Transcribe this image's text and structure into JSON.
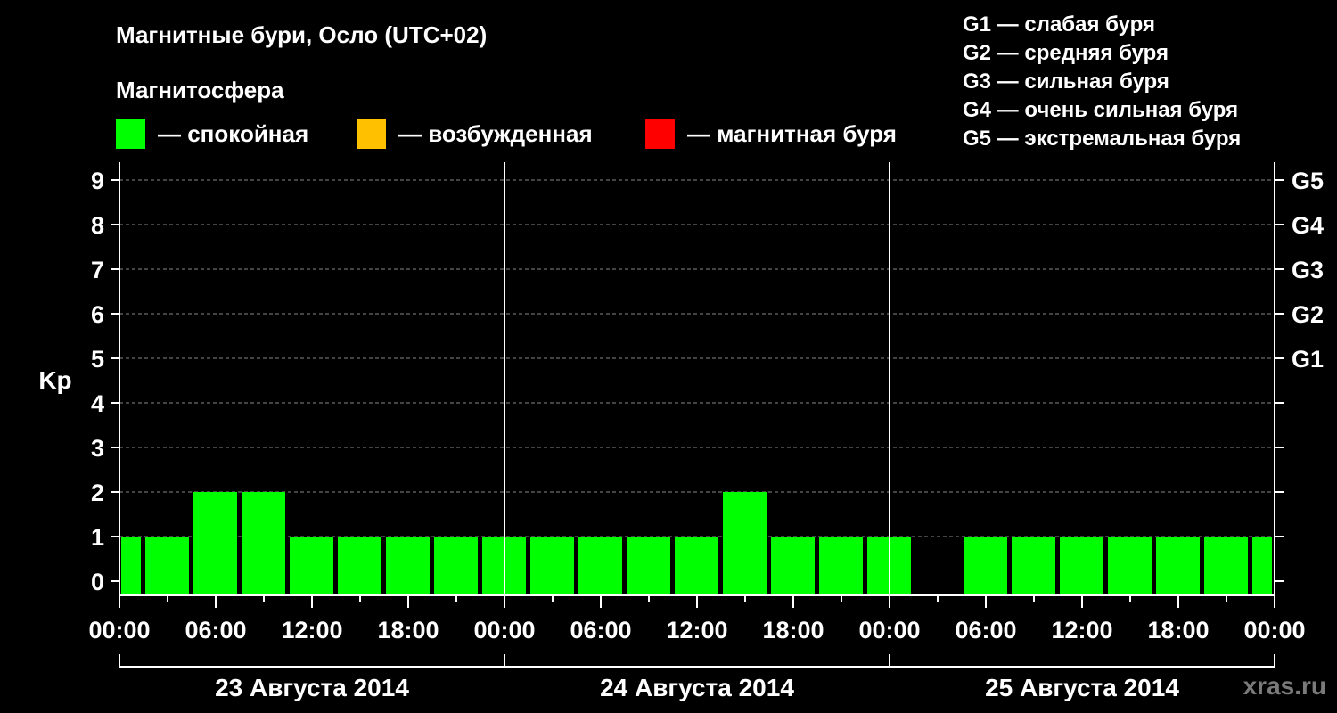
{
  "title": "Магнитные бури, Осло (UTC+02)",
  "subtitle": "Магнитосфера",
  "legend": [
    {
      "label": "— спокойная",
      "color": "#00ff00"
    },
    {
      "label": "— возбужденная",
      "color": "#ffc000"
    },
    {
      "label": "— магнитная буря",
      "color": "#ff0000"
    }
  ],
  "g_legend": [
    "G1 — слабая буря",
    "G2 — средняя буря",
    "G3 — сильная буря",
    "G4 — очень сильная буря",
    "G5 — экстремальная буря"
  ],
  "watermark": "xras.ru",
  "chart_data": {
    "type": "bar",
    "ylabel": "Kp",
    "ylim": [
      0,
      9
    ],
    "yticks": [
      "0",
      "1",
      "2",
      "3",
      "4",
      "5",
      "6",
      "7",
      "8",
      "9"
    ],
    "g_levels": [
      {
        "label": "G1",
        "kp": 5
      },
      {
        "label": "G2",
        "kp": 6
      },
      {
        "label": "G3",
        "kp": 7
      },
      {
        "label": "G4",
        "kp": 8
      },
      {
        "label": "G5",
        "kp": 9
      }
    ],
    "x_tick_labels": [
      "00:00",
      "06:00",
      "12:00",
      "18:00",
      "00:00",
      "06:00",
      "12:00",
      "18:00",
      "00:00",
      "06:00",
      "12:00",
      "18:00",
      "00:00"
    ],
    "days": [
      "23 Августа 2014",
      "24 Августа 2014",
      "25 Августа 2014"
    ],
    "values": [
      1,
      1,
      2,
      2,
      1,
      1,
      1,
      1,
      1,
      1,
      1,
      1,
      1,
      2,
      1,
      1,
      1,
      0,
      1,
      1,
      1,
      1,
      1,
      1,
      1
    ],
    "bar_color": "#00ff00",
    "grid": true
  }
}
